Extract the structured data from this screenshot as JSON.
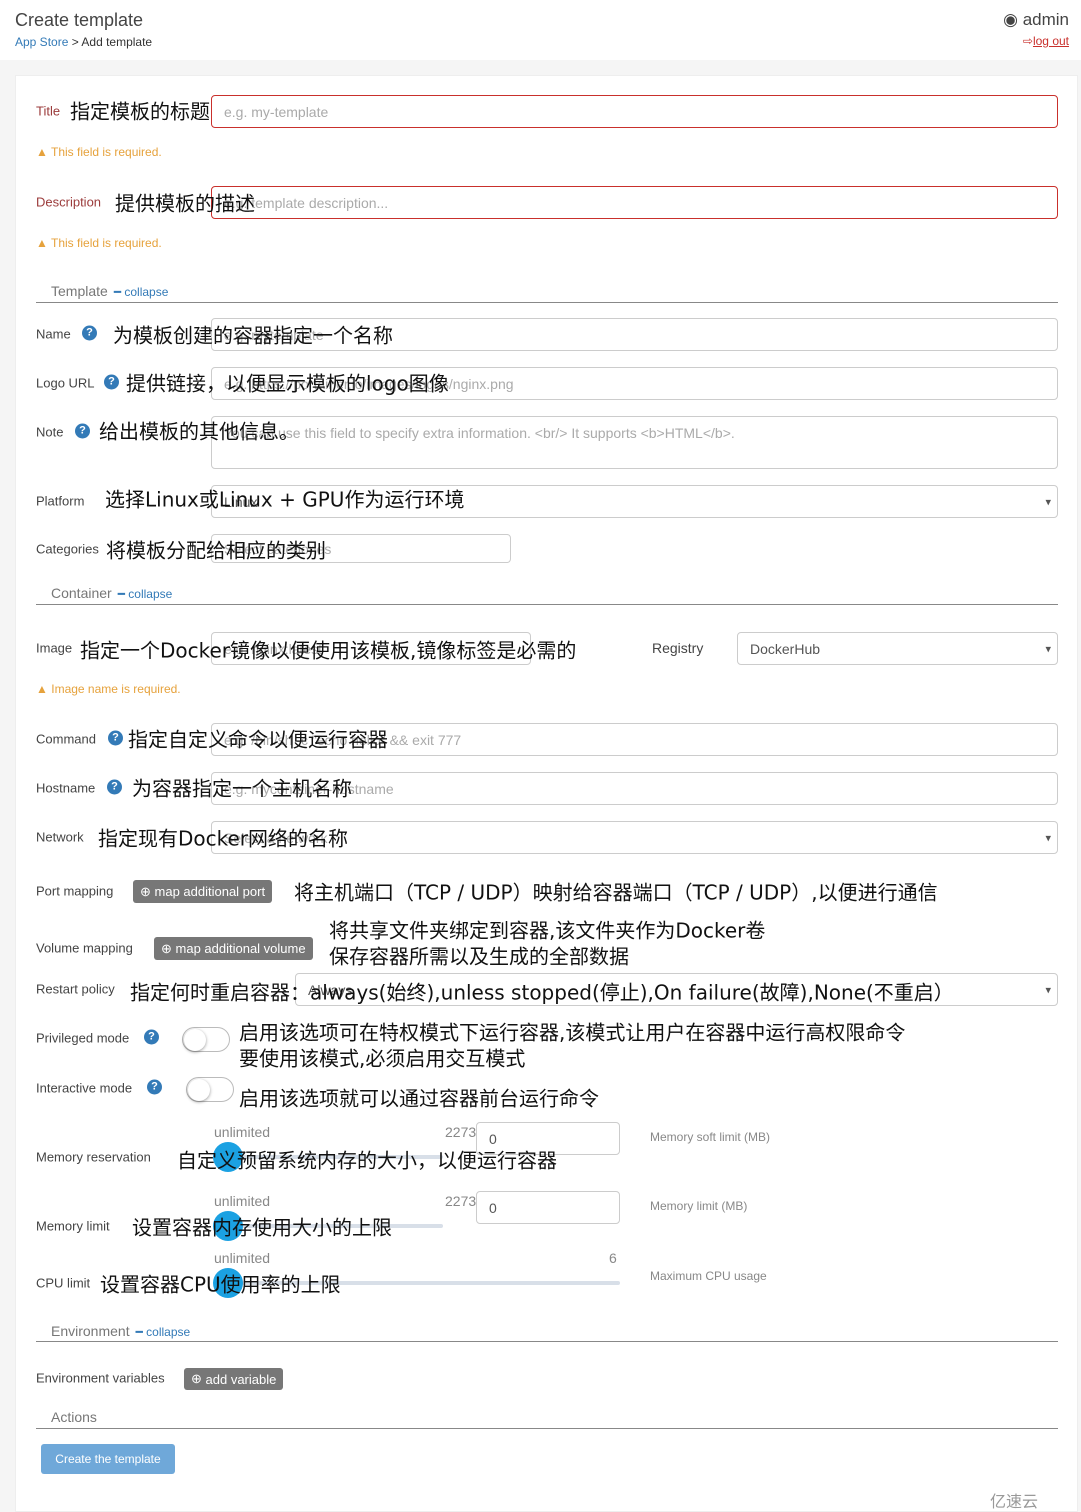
{
  "header": {
    "title": "Create template",
    "breadcrumb_link": "App Store",
    "breadcrumb_sep": " > ",
    "breadcrumb_current": "Add template",
    "user": "admin",
    "logout": "log out"
  },
  "form": {
    "title": {
      "label": "Title",
      "placeholder": "e.g. my-template",
      "error": "This field is required."
    },
    "description": {
      "label": "Description",
      "placeholder": "e.g. template description...",
      "error": "This field is required."
    },
    "template_section": {
      "label": "Template",
      "collapse": "collapse"
    },
    "name": {
      "label": "Name",
      "placeholder": "e.g. mytemplate"
    },
    "logo": {
      "label": "Logo URL",
      "placeholder": "e.g. https://portainer.io/images/logos/nginx.png"
    },
    "note": {
      "label": "Note",
      "placeholder": "You can use this field to specify extra information. <br/> It supports <b>HTML</b>."
    },
    "platform": {
      "label": "Platform",
      "value": "Linux"
    },
    "categories": {
      "label": "Categories",
      "placeholder": "Select categories"
    },
    "container_section": {
      "label": "Container",
      "collapse": "collapse"
    },
    "image": {
      "label": "Image",
      "placeholder": "e.g. nginx:latest",
      "error": "Image name is required."
    },
    "registry": {
      "label": "Registry",
      "value": "DockerHub"
    },
    "command": {
      "label": "Command",
      "placeholder": "e.g. /bin/sh -c \"echo hello\" && exit 777"
    },
    "hostname": {
      "label": "Hostname",
      "placeholder": "e.g. mycontainer-hostname"
    },
    "network": {
      "label": "Network",
      "value": "Select a network"
    },
    "port_mapping": {
      "label": "Port mapping",
      "button": "map additional port"
    },
    "volume_mapping": {
      "label": "Volume mapping",
      "button": "map additional volume"
    },
    "restart_policy": {
      "label": "Restart policy",
      "value": "Always"
    },
    "privileged": {
      "label": "Privileged mode",
      "enabled": false
    },
    "interactive": {
      "label": "Interactive mode",
      "enabled": false
    },
    "memory_reservation": {
      "label": "Memory reservation",
      "min": "unlimited",
      "max": "2273",
      "value": "0",
      "hint": "Memory soft limit (MB)"
    },
    "memory_limit": {
      "label": "Memory limit",
      "min": "unlimited",
      "max": "2273",
      "value": "0",
      "hint": "Memory limit (MB)"
    },
    "cpu_limit": {
      "label": "CPU limit",
      "min": "unlimited",
      "max": "6",
      "hint": "Maximum CPU usage"
    },
    "environment_section": {
      "label": "Environment",
      "collapse": "collapse"
    },
    "env_vars": {
      "label": "Environment variables",
      "button": "add variable"
    },
    "actions_section": {
      "label": "Actions"
    },
    "submit": "Create the template"
  },
  "annotations": {
    "title": "指定模板的标题",
    "description": "提供模板的描述",
    "name": "为模板创建的容器指定一个名称",
    "logo": "提供链接，以便显示模板的logo图像",
    "note": "给出模板的其他信息。",
    "platform": "选择Linux或Linux + GPU作为运行环境",
    "categories": "将模板分配给相应的类别",
    "image": "指定一个Docker镜像以便使用该模板,镜像标签是必需的",
    "command": "指定自定义命令以便运行容器",
    "hostname": "为容器指定一个主机名称",
    "network": "指定现有Docker网络的名称",
    "port": "将主机端口（TCP / UDP）映射给容器端口（TCP / UDP）,以便进行通信",
    "volume1": "将共享文件夹绑定到容器,该文件夹作为Docker卷",
    "volume2": "保存容器所需以及生成的全部数据",
    "restart": "指定何时重启容器：always(始终),unless stopped(停止),On failure(故障),None(不重启）",
    "priv1": "启用该选项可在特权模式下运行容器,该模式让用户在容器中运行高权限命令",
    "priv2": "要使用该模式,必须启用交互模式",
    "interactive": "启用该选项就可以通过容器前台运行命令",
    "memres": "自定义预留系统内存的大小，以便运行容器",
    "memlim": "设置容器内存使用大小的上限",
    "cpu": "设置容器CPU使用率的上限"
  },
  "watermark": "亿速云",
  "colors": {
    "accent": "#337ab7",
    "error": "#c9302c",
    "warning": "#e6a23c",
    "slider": "#1ba1e2"
  }
}
